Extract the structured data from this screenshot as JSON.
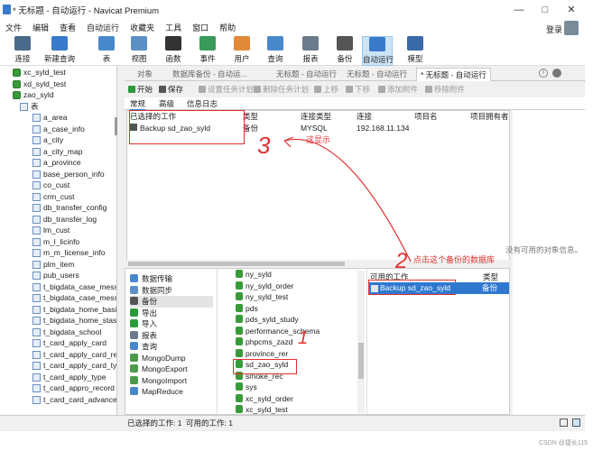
{
  "window": {
    "title": "* 无标题 - 自动运行 - Navicat Premium",
    "controls": [
      "—",
      "□",
      "✕"
    ]
  },
  "menu": [
    "文件",
    "编辑",
    "查看",
    "自动运行",
    "收藏夹",
    "工具",
    "窗口",
    "帮助"
  ],
  "login_label": "登录",
  "toolbar": [
    {
      "label": "连接",
      "icon": "plug-icon",
      "color": "#4a6a8a"
    },
    {
      "label": "新建查询",
      "icon": "new-query-icon",
      "color": "#3a7acb"
    },
    {
      "label": "表",
      "icon": "table-icon",
      "color": "#4a88cc"
    },
    {
      "label": "视图",
      "icon": "view-icon",
      "color": "#5c8fc4"
    },
    {
      "label": "函数",
      "icon": "function-icon",
      "color": "#333333"
    },
    {
      "label": "事件",
      "icon": "clock-icon",
      "color": "#3a9a5a"
    },
    {
      "label": "用户",
      "icon": "user-icon",
      "color": "#e08a3a"
    },
    {
      "label": "查询",
      "icon": "query-icon",
      "color": "#4a88cc"
    },
    {
      "label": "报表",
      "icon": "report-icon",
      "color": "#6b7b8b"
    },
    {
      "label": "备份",
      "icon": "backup-icon",
      "color": "#555555"
    },
    {
      "label": "自动运行",
      "icon": "automation-icon",
      "color": "#3a7acb"
    },
    {
      "label": "模型",
      "icon": "model-icon",
      "color": "#3a6aa8"
    }
  ],
  "tree": [
    {
      "label": "xc_syld_test",
      "kind": "db"
    },
    {
      "label": "xd_syld_test",
      "kind": "db"
    },
    {
      "label": "zao_syld",
      "kind": "db"
    },
    {
      "label": "表",
      "kind": "folder"
    },
    {
      "label": "a_area",
      "kind": "table"
    },
    {
      "label": "a_case_info",
      "kind": "table"
    },
    {
      "label": "a_city",
      "kind": "table"
    },
    {
      "label": "a_city_map",
      "kind": "table"
    },
    {
      "label": "a_province",
      "kind": "table"
    },
    {
      "label": "base_person_info",
      "kind": "table"
    },
    {
      "label": "co_cust",
      "kind": "table"
    },
    {
      "label": "crm_cust",
      "kind": "table"
    },
    {
      "label": "db_transfer_config",
      "kind": "table"
    },
    {
      "label": "db_transfer_log",
      "kind": "table"
    },
    {
      "label": "lm_cust",
      "kind": "table"
    },
    {
      "label": "m_l_licinfo",
      "kind": "table"
    },
    {
      "label": "m_m_license_info",
      "kind": "table"
    },
    {
      "label": "plm_item",
      "kind": "table"
    },
    {
      "label": "pub_users",
      "kind": "table"
    },
    {
      "label": "t_bigdata_case_mess",
      "kind": "table"
    },
    {
      "label": "t_bigdata_case_mess",
      "kind": "table"
    },
    {
      "label": "t_bigdata_home_basi",
      "kind": "table"
    },
    {
      "label": "t_bigdata_home_stas",
      "kind": "table"
    },
    {
      "label": "t_bigdata_school",
      "kind": "table"
    },
    {
      "label": "t_card_apply_card",
      "kind": "table"
    },
    {
      "label": "t_card_apply_card_re",
      "kind": "table"
    },
    {
      "label": "t_card_apply_card_ty",
      "kind": "table"
    },
    {
      "label": "t_card_apply_type",
      "kind": "table"
    },
    {
      "label": "t_card_appro_record",
      "kind": "table"
    },
    {
      "label": "t_card_card_advance",
      "kind": "table"
    }
  ],
  "tabs": [
    {
      "label": "对象"
    },
    {
      "label": "数据库备份 - 自动运..."
    },
    {
      "label": "无标题 - 自动运行"
    },
    {
      "label": "无标题 - 自动运行"
    },
    {
      "label": "* 无标题 - 自动运行"
    }
  ],
  "actions": [
    {
      "label": "开始",
      "enabled": true,
      "color": "#2a9a3a"
    },
    {
      "label": "保存",
      "enabled": true,
      "color": "#555555"
    },
    {
      "label": "设置任务计划",
      "enabled": false,
      "color": "#aaaaaa"
    },
    {
      "label": "删除任务计划",
      "enabled": false,
      "color": "#aaaaaa"
    },
    {
      "label": "上移",
      "enabled": false,
      "color": "#aaaaaa"
    },
    {
      "label": "下移",
      "enabled": false,
      "color": "#aaaaaa"
    },
    {
      "label": "添加附件",
      "enabled": false,
      "color": "#aaaaaa"
    },
    {
      "label": "移除附件",
      "enabled": false,
      "color": "#aaaaaa"
    }
  ],
  "subtabs": [
    "常规",
    "高级",
    "信息日志"
  ],
  "jobs_table": {
    "columns": [
      "已选择的工作",
      "类型",
      "连接类型",
      "连接",
      "项目名",
      "项目拥有者"
    ],
    "rows": [
      [
        "Backup sd_zao_syld",
        "备份",
        "MYSQL",
        "192.168.11.134",
        "",
        ""
      ]
    ]
  },
  "info_text": "没有可用的对象信息。",
  "categories": [
    {
      "label": "数据传输",
      "color": "#4a88cc"
    },
    {
      "label": "数据同步",
      "color": "#5c8fc4"
    },
    {
      "label": "备份",
      "color": "#555555"
    },
    {
      "label": "导出",
      "color": "#2a9a3a"
    },
    {
      "label": "导入",
      "color": "#2a9a3a"
    },
    {
      "label": "报表",
      "color": "#6b7b8b"
    },
    {
      "label": "查询",
      "color": "#4a88cc"
    },
    {
      "label": "MongoDump",
      "color": "#4a9a4a"
    },
    {
      "label": "MongoExport",
      "color": "#4a9a4a"
    },
    {
      "label": "MongoImport",
      "color": "#4a9a4a"
    },
    {
      "label": "MapReduce",
      "color": "#4a88cc"
    }
  ],
  "selected_category": "备份",
  "databases": [
    "ny_syld",
    "ny_syld_order",
    "ny_syld_test",
    "pds",
    "pds_syld_study",
    "performance_schema",
    "phpcms_zazd",
    "province_rer",
    "sd_zao_syld",
    "smoke_rec",
    "sys",
    "xc_syld_order",
    "xc_syld_test"
  ],
  "available": {
    "columns": [
      "可用的工作",
      "类型"
    ],
    "rows": [
      [
        "Backup sd_zao_syld",
        "备份"
      ]
    ]
  },
  "status": {
    "selected": "已选择的工作: 1",
    "available": "可用的工作: 1"
  },
  "annotations": {
    "note1": "这显示",
    "note2": "点击这个备份的数据库",
    "digit1": "1",
    "digit2": "2",
    "digit3": "3"
  },
  "watermark": "CSDN @捷长115"
}
